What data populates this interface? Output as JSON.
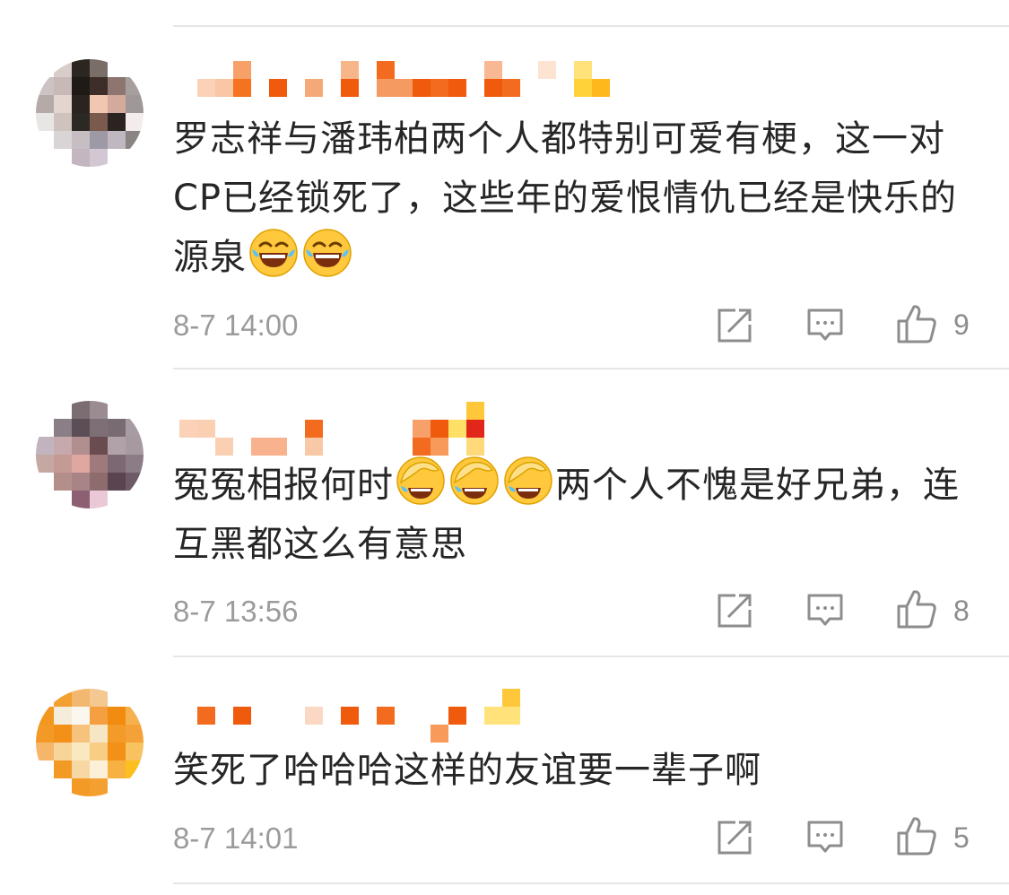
{
  "comments": [
    {
      "text": "罗志祥与潘玮柏两个人都特别可爱有梗，这一对CP已经锁死了，这些年的爱恨情仇已经是快乐的源泉",
      "emojis": [
        "laugh-cry-emoji",
        "laugh-cry-emoji"
      ],
      "time": "8-7 14:00",
      "likes": "9"
    },
    {
      "text_before": "冤冤相报何时",
      "text_after": "两个人不愧是好兄弟，连互黑都这么有意思",
      "emojis": [
        "facepalm-laugh-emoji",
        "facepalm-laugh-emoji",
        "facepalm-laugh-emoji"
      ],
      "time": "8-7 13:56",
      "likes": "8"
    },
    {
      "text": "笑死了哈哈哈这样的友谊要一辈子啊",
      "time": "8-7 14:01",
      "likes": "5"
    }
  ],
  "icons": {
    "repost": "repost-icon",
    "comment": "comment-icon",
    "like": "thumbs-up-icon"
  },
  "colors": {
    "text": "#262626",
    "meta": "#9b9b9b",
    "icon": "#8d8d8d",
    "divider": "#e6e6e6"
  }
}
